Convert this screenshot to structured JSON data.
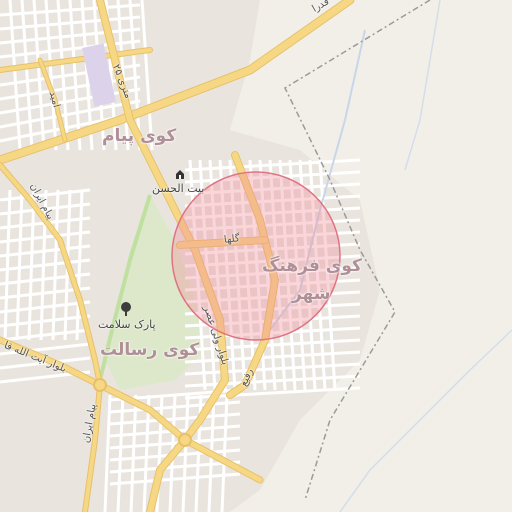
{
  "map": {
    "districts": {
      "payam": "کوی پیام",
      "farhang": "کوی فرهنگ",
      "farhang_line2": "شهر",
      "resalat": "کوی رسالت"
    },
    "streets": {
      "top_blvd": "قدرا",
      "sixteen_dey": "۲۵ متری",
      "omid": "امید",
      "payam_e_iran_1": "پیام ایران",
      "payam_e_iran_2": "پیام ایران",
      "golha": "گلها",
      "asr_blvd": "بلوار ولی عصر",
      "rafi": "رفیع",
      "ayatollah_blvd": "بلوار آیت الله قا"
    },
    "pois": {
      "beit_al_hasan": "بیت الحسن",
      "park_salamat": "پارک سلامت"
    },
    "icons": {
      "beit_al_hasan": "shrine-icon",
      "park_salamat": "park-tree-icon"
    },
    "colors": {
      "background": "#f2efe9",
      "major_road": "#f6d884",
      "major_road_casing": "#e8c06a",
      "minor_road": "#ffffff",
      "block": "#e6e1d9",
      "park": "#cfe7b4",
      "boundary": "#9a9a9a",
      "circle_fill": "#f28a98",
      "circle_stroke": "#e07384",
      "rail": "#c5d4e6"
    }
  }
}
